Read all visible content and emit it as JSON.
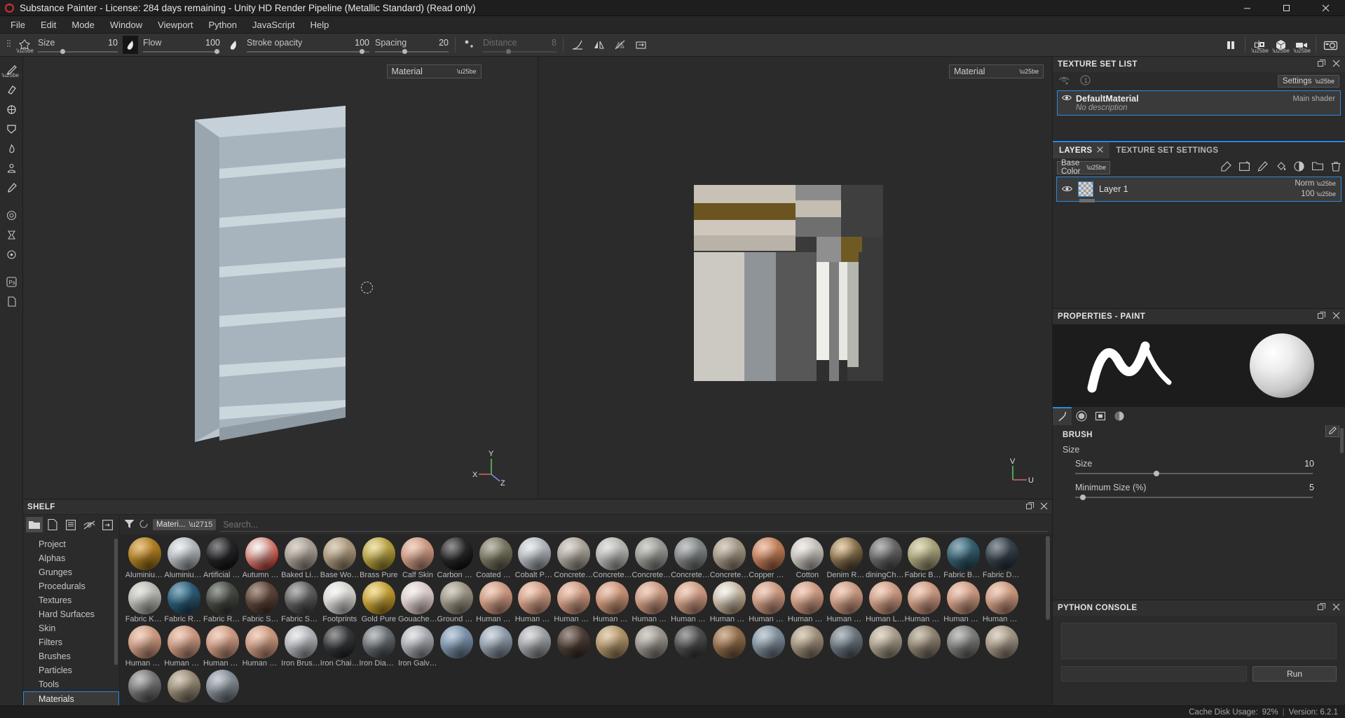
{
  "window": {
    "title": "Substance Painter - License: 284 days remaining - Unity HD Render Pipeline (Metallic Standard) (Read only)",
    "minimize": "─",
    "maximize": "☐",
    "close": "✕"
  },
  "menu": {
    "items": [
      "File",
      "Edit",
      "Mode",
      "Window",
      "Viewport",
      "Python",
      "JavaScript",
      "Help"
    ]
  },
  "toolbar": {
    "size": {
      "label": "Size",
      "value": "10"
    },
    "flow": {
      "label": "Flow",
      "value": "100"
    },
    "stroke_opacity": {
      "label": "Stroke opacity",
      "value": "100"
    },
    "spacing": {
      "label": "Spacing",
      "value": "20"
    },
    "distance": {
      "label": "Distance",
      "value": "8"
    }
  },
  "viewports": {
    "left": {
      "shader": "Material"
    },
    "right": {
      "shader": "Material"
    },
    "axis3d": {
      "x": "X",
      "y": "Y",
      "z": "Z"
    },
    "axis2d": {
      "u": "U",
      "v": "V"
    }
  },
  "shelf": {
    "title": "SHELF",
    "filter_chip": "Materi...",
    "search_placeholder": "Search...",
    "categories": [
      "Project",
      "Alphas",
      "Grunges",
      "Procedurals",
      "Textures",
      "Hard Surfaces",
      "Skin",
      "Filters",
      "Brushes",
      "Particles",
      "Tools",
      "Materials"
    ],
    "selected_category": "Materials",
    "materials": [
      {
        "label": "Aluminium ...",
        "c1": "#d9a23c",
        "c2": "#8a6114"
      },
      {
        "label": "Aluminium ...",
        "c1": "#e3e6ea",
        "c2": "#8d9399"
      },
      {
        "label": "Artificial Lea...",
        "c1": "#3b3b3e",
        "c2": "#131315"
      },
      {
        "label": "Autumn Leaf",
        "c1": "#f2f0ec",
        "c2": "#b7362a"
      },
      {
        "label": "Baked Light...",
        "c1": "#c6bdb2",
        "c2": "#8d857c"
      },
      {
        "label": "Base Wood...",
        "c1": "#cbb79c",
        "c2": "#8e7c63"
      },
      {
        "label": "Brass Pure",
        "c1": "#e6d27a",
        "c2": "#8e7a21"
      },
      {
        "label": "Calf Skin",
        "c1": "#eab9a3",
        "c2": "#b08069"
      },
      {
        "label": "Carbon Fiber",
        "c1": "#4a4a4c",
        "c2": "#0e0e10"
      },
      {
        "label": "Coated Metal",
        "c1": "#9b9781",
        "c2": "#5d5a48"
      },
      {
        "label": "Cobalt Pure",
        "c1": "#dfe3e8",
        "c2": "#8c9096"
      },
      {
        "label": "Concrete B...",
        "c1": "#ccc6bc",
        "c2": "#8d877e"
      },
      {
        "label": "Concrete Cl...",
        "c1": "#d3d3d0",
        "c2": "#9a9a97"
      },
      {
        "label": "Concrete D...",
        "c1": "#b9b9b5",
        "c2": "#7e7e7a"
      },
      {
        "label": "Concrete Si...",
        "c1": "#a3a7a7",
        "c2": "#66696a"
      },
      {
        "label": "Concrete S...",
        "c1": "#c2b5a2",
        "c2": "#877c6c"
      },
      {
        "label": "Copper Pure",
        "c1": "#e8a884",
        "c2": "#9c5d3c"
      },
      {
        "label": "Cotton",
        "c1": "#e7e3dc",
        "c2": "#a9a59e"
      },
      {
        "label": "Denim Rivet",
        "c1": "#d9b683",
        "c2": "#4f412c"
      },
      {
        "label": "diningChair...",
        "c1": "#8d8d8d",
        "c2": "#4a4a4a"
      },
      {
        "label": "Fabric Bam...",
        "c1": "#cfc99a",
        "c2": "#8a8564"
      },
      {
        "label": "Fabric Base...",
        "c1": "#4e8193",
        "c2": "#254350"
      },
      {
        "label": "Fabric Deni...",
        "c1": "#4c5a64",
        "c2": "#242c33"
      },
      {
        "label": "Fabric Knitt...",
        "c1": "#d9d9d2",
        "c2": "#9b9b95"
      },
      {
        "label": "Fabric Rough",
        "c1": "#3f7d9c",
        "c2": "#1d4054"
      },
      {
        "label": "Fabric Rou...",
        "c1": "#5f645d",
        "c2": "#33372f"
      },
      {
        "label": "Fabric Soft ...",
        "c1": "#7c5c4c",
        "c2": "#43302a"
      },
      {
        "label": "Fabric Suit ...",
        "c1": "#8c8c8c",
        "c2": "#3f3f3f"
      },
      {
        "label": "Footprints",
        "c1": "#f3f2ef",
        "c2": "#b9b8b5"
      },
      {
        "label": "Gold Pure",
        "c1": "#efd06a",
        "c2": "#9a7715"
      },
      {
        "label": "Gouache P...",
        "c1": "#efe8e6",
        "c2": "#c4b0ae"
      },
      {
        "label": "Ground Gra...",
        "c1": "#bdb6a3",
        "c2": "#7d776a"
      },
      {
        "label": "Human Bac...",
        "c1": "#eab9a0",
        "c2": "#b07f69"
      },
      {
        "label": "Human Bell...",
        "c1": "#eebda5",
        "c2": "#b2816c"
      },
      {
        "label": "Human Bu...",
        "c1": "#ecb9a1",
        "c2": "#b07e68"
      },
      {
        "label": "Human Ch...",
        "c1": "#e8b396",
        "c2": "#ab7960"
      },
      {
        "label": "Human Eye...",
        "c1": "#eab9a1",
        "c2": "#ad7e68"
      },
      {
        "label": "Human Fac...",
        "c1": "#ecbba3",
        "c2": "#b0806a"
      },
      {
        "label": "Human Fe...",
        "c1": "#f0efe9",
        "c2": "#a38b6e"
      },
      {
        "label": "Human For...",
        "c1": "#eab9a0",
        "c2": "#ad7e68"
      },
      {
        "label": "Human For...",
        "c1": "#ecbba2",
        "c2": "#af7f69"
      },
      {
        "label": "Human He...",
        "c1": "#eab9a0",
        "c2": "#ad7e68"
      },
      {
        "label": "Human Leg...",
        "c1": "#ecbba2",
        "c2": "#af7f69"
      },
      {
        "label": "Human Mo...",
        "c1": "#eab9a0",
        "c2": "#ad7e68"
      },
      {
        "label": "Human Ne...",
        "c1": "#ecbba2",
        "c2": "#af7f69"
      },
      {
        "label": "Human Ne...",
        "c1": "#eab9a0",
        "c2": "#ad7e68"
      },
      {
        "label": "Human No...",
        "c1": "#ecbba2",
        "c2": "#af7f69"
      },
      {
        "label": "Human No...",
        "c1": "#eab9a0",
        "c2": "#ad7e68"
      },
      {
        "label": "Human Shi...",
        "c1": "#ecbba2",
        "c2": "#af7f69"
      },
      {
        "label": "Human Wri...",
        "c1": "#eab9a0",
        "c2": "#ad7e68"
      },
      {
        "label": "Iron Brushed",
        "c1": "#dfe2e5",
        "c2": "#8b8f93"
      },
      {
        "label": "Iron Chain...",
        "c1": "#55585a",
        "c2": "#1e2022"
      },
      {
        "label": "Iron Diamo...",
        "c1": "#9aa0a4",
        "c2": "#42464a"
      },
      {
        "label": "Iron Galvan...",
        "c1": "#d6dade",
        "c2": "#82868a"
      },
      {
        "label": "",
        "c1": "#9fb8cf",
        "c2": "#5d7287"
      },
      {
        "label": "",
        "c1": "#b9c6d3",
        "c2": "#6e7986"
      },
      {
        "label": "",
        "c1": "#c9ccd0",
        "c2": "#7d8083"
      },
      {
        "label": "",
        "c1": "#6b564a",
        "c2": "#342a24"
      },
      {
        "label": "",
        "c1": "#d9bc8c",
        "c2": "#8d7552"
      },
      {
        "label": "",
        "c1": "#c0bbb2",
        "c2": "#797570"
      },
      {
        "label": "",
        "c1": "#6e6e70",
        "c2": "#343436"
      },
      {
        "label": "",
        "c1": "#b88d63",
        "c2": "#6e5238"
      },
      {
        "label": "",
        "c1": "#a6b6c4",
        "c2": "#5f6b76"
      },
      {
        "label": "",
        "c1": "#c9b69c",
        "c2": "#7d7060"
      },
      {
        "label": "",
        "c1": "#8e9aa4",
        "c2": "#4f5760"
      },
      {
        "label": "",
        "c1": "#d2c4ae",
        "c2": "#867c6d"
      },
      {
        "label": "",
        "c1": "#b7a992",
        "c2": "#6e6558"
      },
      {
        "label": "",
        "c1": "#a3a39f",
        "c2": "#5f5f5c"
      },
      {
        "label": "",
        "c1": "#cdbfa9",
        "c2": "#7f7468"
      },
      {
        "label": "",
        "c1": "#9c9c9c",
        "c2": "#555555"
      },
      {
        "label": "",
        "c1": "#bfae96",
        "c2": "#736a5a"
      },
      {
        "label": "",
        "c1": "#aab4bd",
        "c2": "#636a71"
      }
    ]
  },
  "texture_set_list": {
    "title": "TEXTURE SET LIST",
    "settings_label": "Settings",
    "entries": [
      {
        "name": "DefaultMaterial",
        "description": "No description",
        "shader": "Main shader"
      }
    ]
  },
  "layers": {
    "tab_layers": "LAYERS",
    "tab_texture_set_settings": "TEXTURE SET SETTINGS",
    "channel": "Base Color",
    "rows": [
      {
        "name": "Layer 1",
        "blend": "Norm",
        "opacity": "100"
      }
    ]
  },
  "properties": {
    "title": "PROPERTIES - PAINT",
    "brush_section": "BRUSH",
    "size_group": "Size",
    "size": {
      "label": "Size",
      "value": "10"
    },
    "minimum_size": {
      "label": "Minimum Size (%)",
      "value": "5"
    }
  },
  "python_console": {
    "title": "PYTHON CONSOLE",
    "run_label": "Run"
  },
  "statusbar": {
    "cache_label": "Cache Disk Usage:",
    "cache_value": "92%",
    "version": "Version: 6.2.1"
  },
  "colors": {
    "accent": "#2a8ae0",
    "panel": "#2b2b2b",
    "header": "#303030"
  }
}
